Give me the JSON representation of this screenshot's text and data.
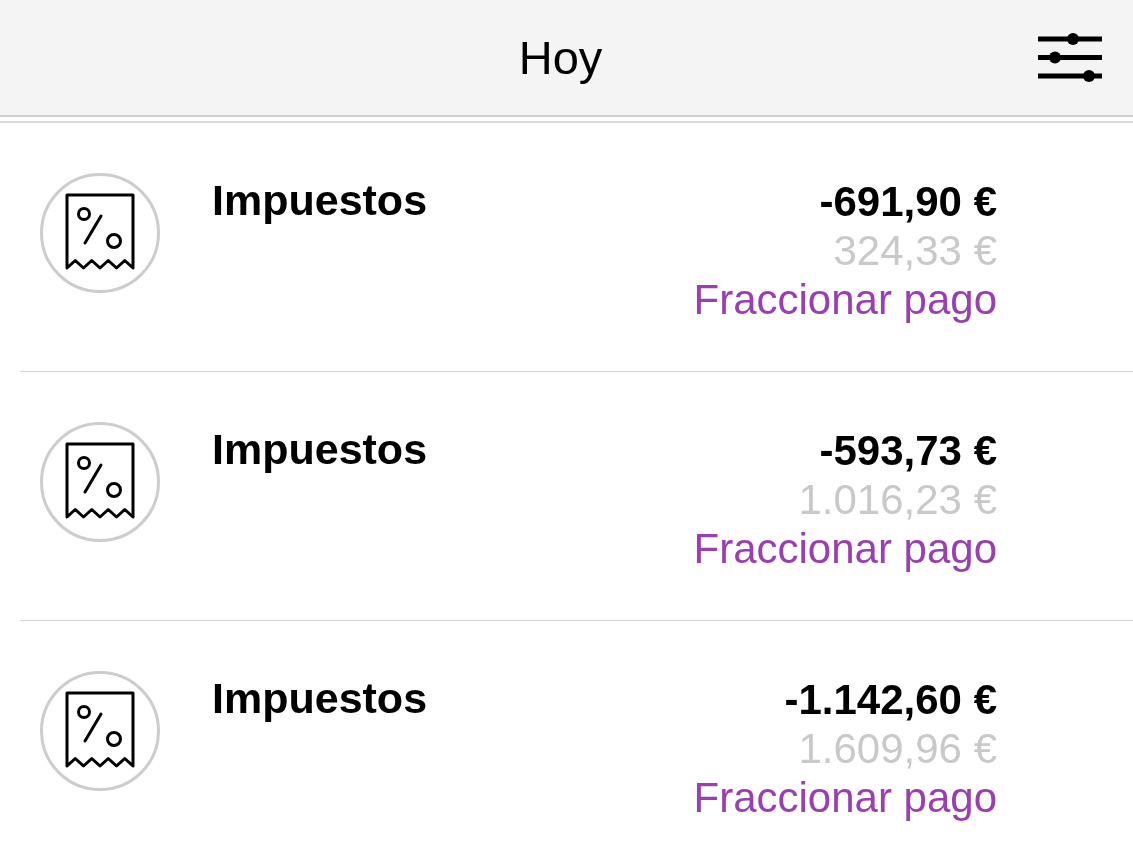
{
  "header": {
    "title": "Hoy"
  },
  "transactions": [
    {
      "title": "Impuestos",
      "amount": "-691,90 €",
      "secondary_amount": "324,33 €",
      "action": "Fraccionar pago"
    },
    {
      "title": "Impuestos",
      "amount": "-593,73 €",
      "secondary_amount": "1.016,23 €",
      "action": "Fraccionar pago"
    },
    {
      "title": "Impuestos",
      "amount": "-1.142,60 €",
      "secondary_amount": "1.609,96 €",
      "action": "Fraccionar pago"
    }
  ]
}
